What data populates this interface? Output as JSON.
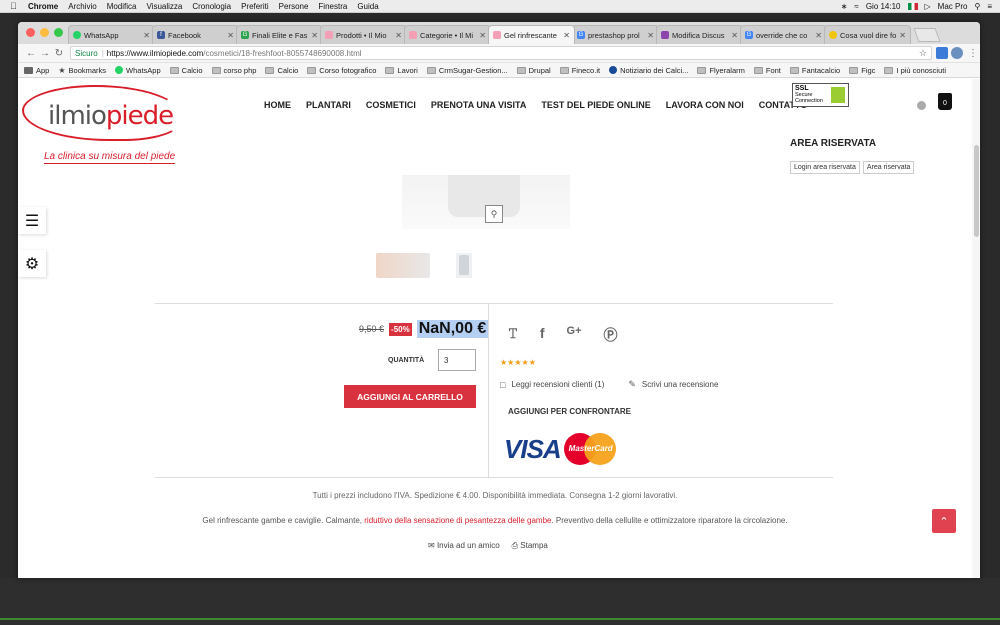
{
  "menubar": {
    "app": "Chrome",
    "items": [
      "Archivio",
      "Modifica",
      "Visualizza",
      "Cronologia",
      "Preferiti",
      "Persone",
      "Finestra",
      "Guida"
    ],
    "clock": "Gio 14:10",
    "user": "Mac Pro"
  },
  "tabs": [
    {
      "title": "WhatsApp",
      "color": "#25d366"
    },
    {
      "title": "Facebook",
      "color": "#3b5998"
    },
    {
      "title": "Finali Elite e Fas",
      "color": "#2ea44f"
    },
    {
      "title": "Prodotti • Il Mio",
      "color": "#f4a0b4"
    },
    {
      "title": "Categorie • Il Mi",
      "color": "#f4a0b4"
    },
    {
      "title": "Gel rinfrescante",
      "color": "#f4a0b4",
      "active": true
    },
    {
      "title": "prestashop prol",
      "color": "#4285f4"
    },
    {
      "title": "Modifica Discus",
      "color": "#8e44ad"
    },
    {
      "title": "override che co",
      "color": "#4285f4"
    },
    {
      "title": "Cosa vuol dire fo",
      "color": "#f1c40f"
    }
  ],
  "address": {
    "secure_label": "Sicuro",
    "host": "https://www.ilmiopiede.com",
    "path": "/cosmetici/18-freshfoot-8055748690008.html"
  },
  "bookmarks": [
    "App",
    "Bookmarks",
    "WhatsApp",
    "Calcio",
    "corso php",
    "Calcio",
    "Corso fotografico",
    "Lavori",
    "CrmSugar-Gestion...",
    "Drupal",
    "Fineco.it",
    "Notiziario dei Calci...",
    "Flyeralarm",
    "Font",
    "Fantacalcio",
    "Figc",
    "I più conosciuti"
  ],
  "site": {
    "logo_word_a": "ilmio",
    "logo_word_b": "piede",
    "logo_tagline": "La clinica su misura del piede",
    "nav": [
      "HOME",
      "PLANTARI",
      "COSMETICI",
      "PRENOTA UNA VISITA",
      "TEST DEL PIEDE ONLINE",
      "LAVORA CON NOI",
      "CONTATTO"
    ],
    "ssl_line1": "SSL",
    "ssl_line2": "Secure",
    "ssl_line3": "Connection",
    "cart_count": "0",
    "area_title": "AREA RISERVATA",
    "area_login": "Login area riservata",
    "area_reserved": "Area riservata"
  },
  "product": {
    "old_price": "9,50 €",
    "discount": "-50%",
    "price": "NaN,00 €",
    "qty_label": "QUANTITÀ",
    "qty_value": "3",
    "add_to_cart": "AGGIUNGI AL CARRELLO",
    "stars": "★★★★★",
    "reviews_read": "Leggi recensioni clienti (1)",
    "reviews_write": "Scrivi una recensione",
    "compare": "AGGIUNGI PER CONFRONTARE",
    "visa": "VISA",
    "mastercard": "MasterCard",
    "info": "Tutti i prezzi includono l'IVA. Spedizione € 4.00. Disponibilità immediata. Consegna 1-2 giorni lavorativi.",
    "desc_a": "Gel rinfrescante gambe e caviglie. Calmante, ",
    "desc_red": "riduttivo della sensazione di pesantezza delle gambe",
    "desc_b": ". Preventivo della cellulite e ottimizzatore riparatore la circolazione.",
    "send_friend": "Invia ad un amico",
    "print": "Stampa"
  }
}
